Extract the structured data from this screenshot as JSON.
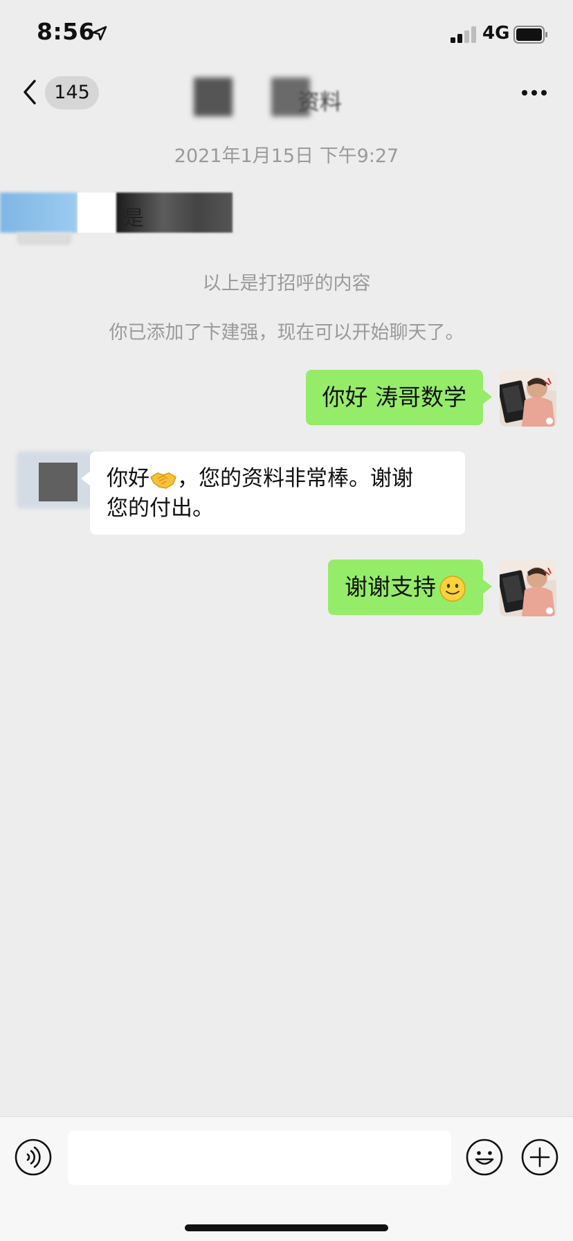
{
  "status_bar": {
    "time": "8:56",
    "network": "4G"
  },
  "nav": {
    "unread_count": "145",
    "title_visible": "资料"
  },
  "chat": {
    "timestamp": "2021年1月15日 下午9:27",
    "greeting_fragment": "是",
    "system_notes": [
      "以上是打招呼的内容",
      "你已添加了卞建强，现在可以开始聊天了。"
    ],
    "messages": [
      {
        "direction": "out",
        "text": "你好 涛哥数学"
      },
      {
        "direction": "in",
        "line1_prefix": "你好",
        "line1_emoji": "handshake",
        "line1_suffix": "，您的资料非常棒。谢谢",
        "line2": "您的付出。"
      },
      {
        "direction": "out",
        "text": "谢谢支持",
        "emoji": "smiling-face"
      }
    ]
  },
  "input_bar": {
    "placeholder": ""
  },
  "colors": {
    "background": "#ededed",
    "outgoing_bubble": "#95ec69",
    "incoming_bubble": "#ffffff",
    "system_text": "#9a9a9a"
  }
}
